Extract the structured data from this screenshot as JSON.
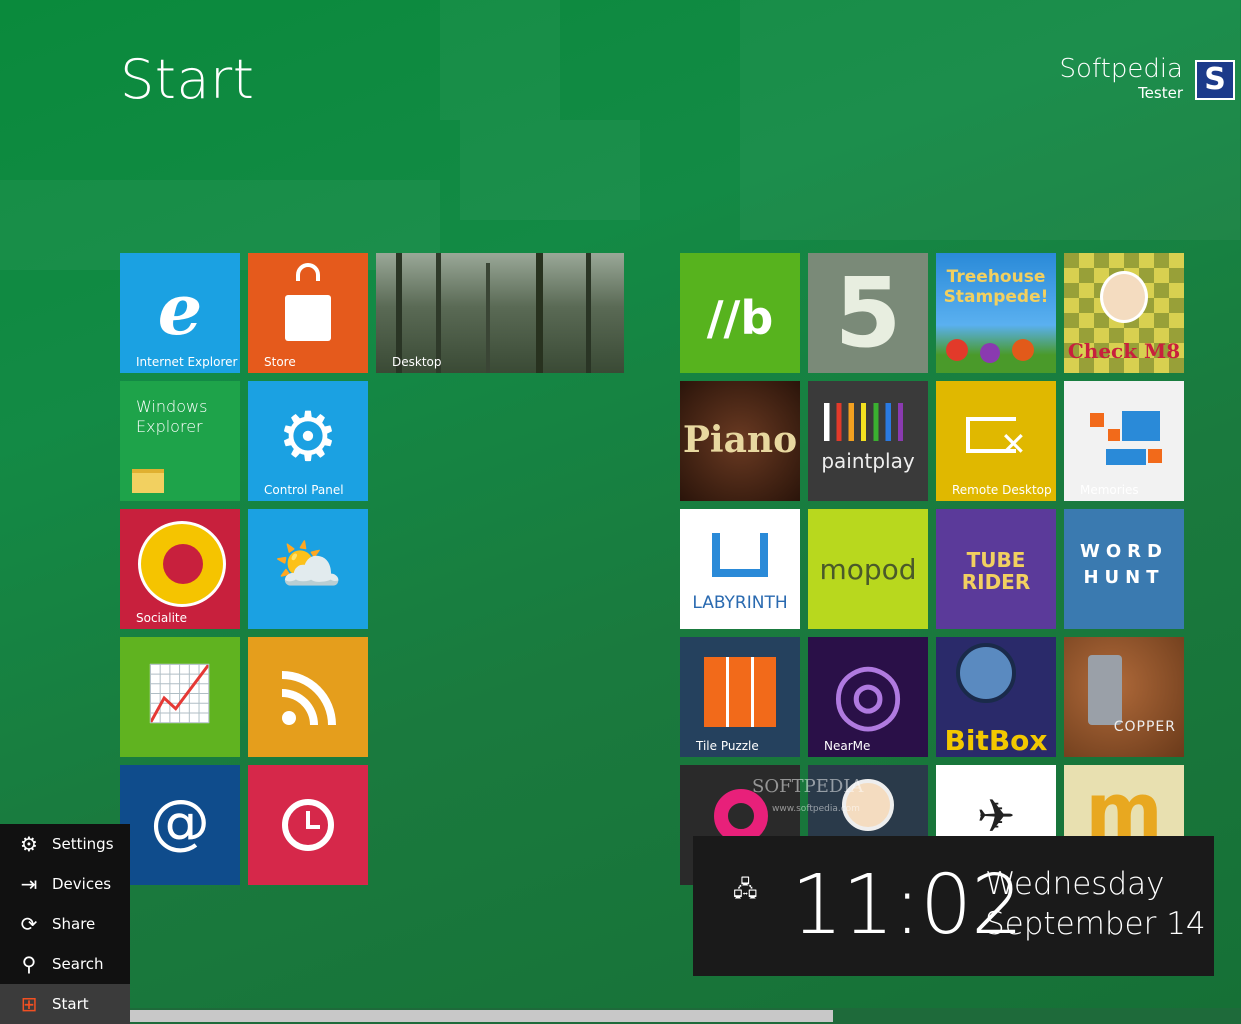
{
  "header": {
    "title": "Start"
  },
  "user": {
    "name": "Softpedia",
    "role": "Tester",
    "avatar_letter": "S"
  },
  "tiles_left": [
    {
      "id": "internet-explorer",
      "label": "Internet Explorer",
      "color": "#1ba1e2",
      "glyph": "e",
      "icon": "ie-icon"
    },
    {
      "id": "store",
      "label": "Store",
      "color": "#e55a1c",
      "glyph": "🛍",
      "icon": "store-bag-icon"
    },
    {
      "id": "desktop",
      "label": "Desktop",
      "color": "#4a5a45",
      "icon": "forest-wallpaper"
    },
    {
      "id": "windows-explorer",
      "label": "Windows\nExplorer",
      "color": "#1ea34a",
      "icon": "folder-icon"
    },
    {
      "id": "control-panel",
      "label": "Control Panel",
      "color": "#1ba1e2",
      "glyph": "⚙",
      "icon": "gear-icon"
    },
    {
      "id": "socialite",
      "label": "Socialite",
      "color": "#c8203d",
      "icon": "speech-bubble-icon"
    },
    {
      "id": "weather",
      "label": "",
      "color": "#1ba1e2",
      "glyph": "⛅",
      "icon": "weather-icon"
    },
    {
      "id": "stocks",
      "label": "",
      "color": "#60b320",
      "glyph": "📈",
      "icon": "stocks-chart-icon"
    },
    {
      "id": "rss",
      "label": "",
      "color": "#e59e1c",
      "glyph": "))",
      "icon": "rss-icon"
    },
    {
      "id": "mail",
      "label": "",
      "color": "#0f4c8c",
      "glyph": "@",
      "icon": "at-icon"
    },
    {
      "id": "alarms",
      "label": "",
      "color": "#d6284a",
      "glyph": "⏰",
      "icon": "alarm-clock-icon"
    }
  ],
  "tiles_right": [
    {
      "id": "bing",
      "label": "",
      "color": "#57b31e",
      "text": "//b",
      "icon": "bing-logo"
    },
    {
      "id": "five",
      "label": "",
      "color": "#7a8a78",
      "text": "5",
      "icon": "five-logo"
    },
    {
      "id": "treehouse",
      "label": "",
      "color": "#3a8ad0",
      "text": "Treehouse Stampede!",
      "icon": "treehouse-logo"
    },
    {
      "id": "checkm8",
      "label": "",
      "color": "#b8b040",
      "text": "Check M8",
      "icon": "checkm8-logo"
    },
    {
      "id": "piano",
      "label": "",
      "color": "#3b2418",
      "text": "Piano",
      "icon": "piano-logo"
    },
    {
      "id": "paintplay",
      "label": "",
      "color": "#3a3a3a",
      "text": "paintplay",
      "icon": "paintplay-logo"
    },
    {
      "id": "remote-desktop",
      "label": "Remote Desktop",
      "color": "#e0b800",
      "glyph": "⤢",
      "icon": "remote-desktop-icon"
    },
    {
      "id": "memories",
      "label": "Memories",
      "color": "#f2f2f2",
      "icon": "memories-icon"
    },
    {
      "id": "labyrinth",
      "label": "LABYRINTH",
      "color": "#ffffff",
      "icon": "labyrinth-icon"
    },
    {
      "id": "mopod",
      "label": "",
      "color": "#b8d81e",
      "text": "mopod",
      "icon": "mopod-logo"
    },
    {
      "id": "tube-rider",
      "label": "",
      "color": "#5b3a9a",
      "text": "TUBE RIDER",
      "icon": "tube-rider-logo"
    },
    {
      "id": "word-hunt",
      "label": "",
      "color": "#3a7ab0",
      "text": "WORD HUNT",
      "icon": "word-hunt-logo"
    },
    {
      "id": "tile-puzzle",
      "label": "Tile Puzzle",
      "color": "#25415e",
      "icon": "tile-puzzle-icon"
    },
    {
      "id": "nearme",
      "label": "NearMe",
      "color": "#2a1048",
      "glyph": "◎",
      "icon": "nearme-icon"
    },
    {
      "id": "bitbox",
      "label": "",
      "color": "#2a2a6a",
      "text": "BitBox",
      "icon": "bitbox-logo"
    },
    {
      "id": "copper",
      "label": "",
      "color": "#8a4a2a",
      "text": "COPPER",
      "icon": "copper-robot-icon"
    },
    {
      "id": "pdf-app",
      "label": "",
      "color": "#2a2a2a",
      "text": "p",
      "icon": "p-logo"
    },
    {
      "id": "cosmo",
      "label": "",
      "color": "#2a3a4a",
      "text": "",
      "icon": "astronaut-icon"
    },
    {
      "id": "paper-plane",
      "label": "",
      "color": "#ffffff",
      "glyph": "✈",
      "icon": "paper-plane-icon"
    },
    {
      "id": "m-app",
      "label": "",
      "color": "#e8e0b0",
      "text": "m",
      "icon": "m-logo"
    }
  ],
  "watermark": {
    "text": "SOFTPEDIA",
    "sub": "www.softpedia.com"
  },
  "charms": [
    {
      "label": "Settings",
      "icon": "gear-icon",
      "glyph": "⚙"
    },
    {
      "label": "Devices",
      "icon": "devices-icon",
      "glyph": "⇥"
    },
    {
      "label": "Share",
      "icon": "share-icon",
      "glyph": "⟳"
    },
    {
      "label": "Search",
      "icon": "search-icon",
      "glyph": "⚲"
    },
    {
      "label": "Start",
      "icon": "windows-logo-icon",
      "glyph": "⊞"
    }
  ],
  "clock": {
    "time": "11:02",
    "day": "Wednesday",
    "date": "September 14",
    "network_icon": "network-icon"
  },
  "scrollbar": {
    "position_fraction": 0.63
  }
}
